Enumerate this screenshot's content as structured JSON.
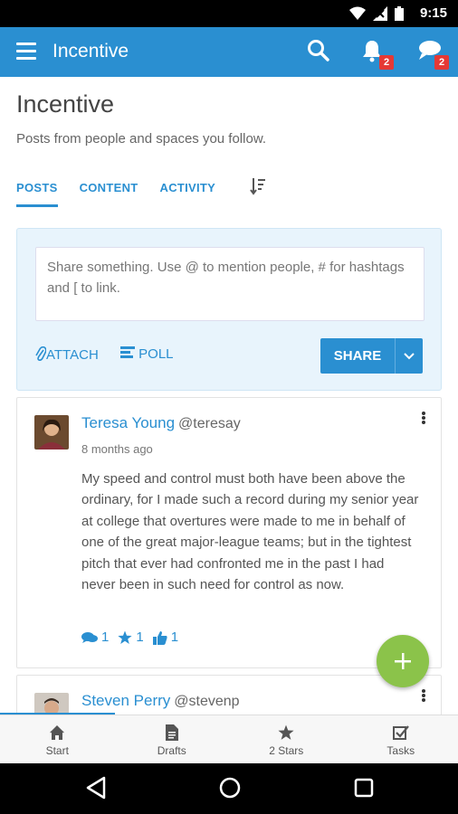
{
  "status": {
    "time": "9:15"
  },
  "appbar": {
    "title": "Incentive",
    "notifications_count": "2",
    "messages_count": "2"
  },
  "header": {
    "title": "Incentive",
    "subtitle": "Posts from people and spaces you follow."
  },
  "tabs": [
    {
      "label": "POSTS"
    },
    {
      "label": "CONTENT"
    },
    {
      "label": "ACTIVITY"
    }
  ],
  "composer": {
    "placeholder": "Share something. Use @ to mention people, # for hashtags and [ to link.",
    "attach_label": "ATTACH",
    "poll_label": "POLL",
    "share_label": "SHARE"
  },
  "posts": [
    {
      "author": "Teresa Young",
      "handle": "@teresay",
      "time": "8 months ago",
      "body": "My speed and control must both have been above the ordinary, for I made such a record during my senior year at college that overtures were made to me in behalf of one of the great major-league teams; but in the tightest pitch that ever had confronted me in the past I had never been in such need for control as now.",
      "comments": "1",
      "stars": "1",
      "likes": "1"
    },
    {
      "author": "Steven Perry",
      "handle": "@stevenp"
    }
  ],
  "bottom_nav": [
    {
      "label": "Start",
      "icon": "home-icon"
    },
    {
      "label": "Drafts",
      "icon": "document-icon"
    },
    {
      "label": "2 Stars",
      "icon": "star-icon"
    },
    {
      "label": "Tasks",
      "icon": "checkbox-icon"
    }
  ],
  "colors": {
    "primary": "#2a8fd1",
    "fab": "#8bc34a",
    "badge": "#e53935"
  }
}
